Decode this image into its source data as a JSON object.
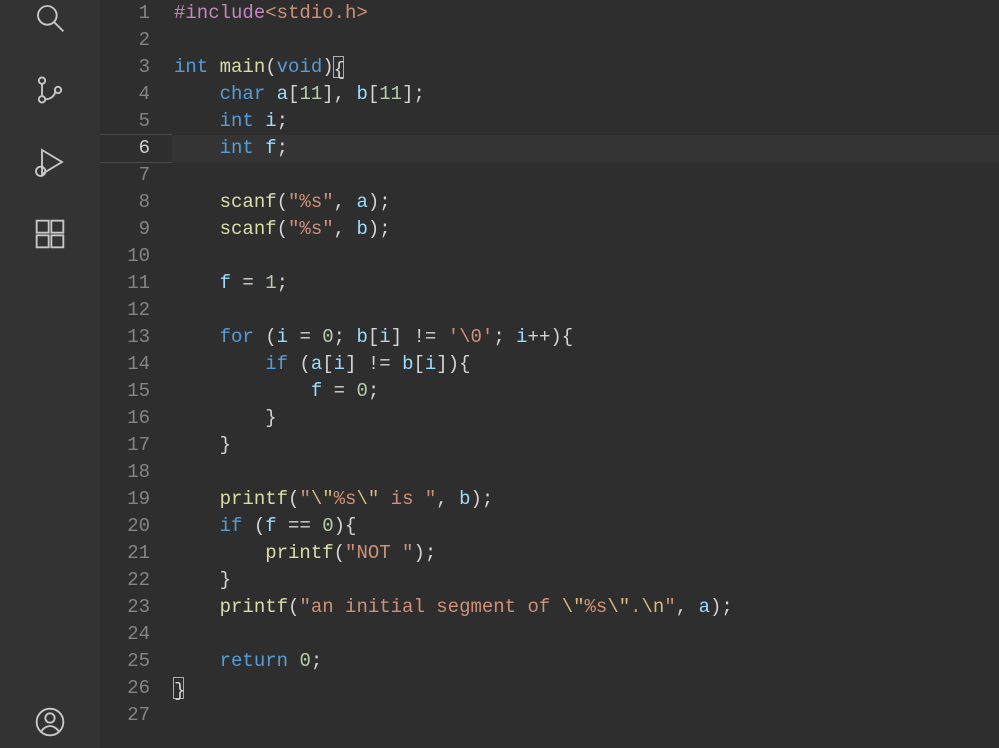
{
  "editor": {
    "active_line": 6,
    "total_lines": 27,
    "lines": [
      [
        {
          "t": "#include",
          "c": "pp"
        },
        {
          "t": "<stdio.h>",
          "c": "str"
        }
      ],
      [],
      [
        {
          "t": "int",
          "c": "type"
        },
        {
          "t": " ",
          "c": "pun"
        },
        {
          "t": "main",
          "c": "fn"
        },
        {
          "t": "(",
          "c": "pun"
        },
        {
          "t": "void",
          "c": "type"
        },
        {
          "t": ")",
          "c": "pun"
        },
        {
          "t": "{",
          "c": "pun",
          "cursor": true
        }
      ],
      [
        {
          "t": "    ",
          "c": "pun",
          "ind": 1
        },
        {
          "t": "char",
          "c": "type"
        },
        {
          "t": " ",
          "c": "pun"
        },
        {
          "t": "a",
          "c": "var"
        },
        {
          "t": "[",
          "c": "pun"
        },
        {
          "t": "11",
          "c": "num"
        },
        {
          "t": "], ",
          "c": "pun"
        },
        {
          "t": "b",
          "c": "var"
        },
        {
          "t": "[",
          "c": "pun"
        },
        {
          "t": "11",
          "c": "num"
        },
        {
          "t": "];",
          "c": "pun"
        }
      ],
      [
        {
          "t": "    ",
          "c": "pun",
          "ind": 1
        },
        {
          "t": "int",
          "c": "type"
        },
        {
          "t": " ",
          "c": "pun"
        },
        {
          "t": "i",
          "c": "var"
        },
        {
          "t": ";",
          "c": "pun"
        }
      ],
      [
        {
          "t": "    ",
          "c": "pun",
          "ind": 1
        },
        {
          "t": "int",
          "c": "type"
        },
        {
          "t": " ",
          "c": "pun"
        },
        {
          "t": "f",
          "c": "var"
        },
        {
          "t": ";",
          "c": "pun"
        }
      ],
      [
        {
          "t": "",
          "c": "pun"
        }
      ],
      [
        {
          "t": "    ",
          "c": "pun",
          "ind": 1
        },
        {
          "t": "scanf",
          "c": "fn"
        },
        {
          "t": "(",
          "c": "pun"
        },
        {
          "t": "\"%s\"",
          "c": "str"
        },
        {
          "t": ", ",
          "c": "pun"
        },
        {
          "t": "a",
          "c": "var"
        },
        {
          "t": ");",
          "c": "pun"
        }
      ],
      [
        {
          "t": "    ",
          "c": "pun",
          "ind": 1
        },
        {
          "t": "scanf",
          "c": "fn"
        },
        {
          "t": "(",
          "c": "pun"
        },
        {
          "t": "\"%s\"",
          "c": "str"
        },
        {
          "t": ", ",
          "c": "pun"
        },
        {
          "t": "b",
          "c": "var"
        },
        {
          "t": ");",
          "c": "pun"
        }
      ],
      [
        {
          "t": "",
          "c": "pun"
        }
      ],
      [
        {
          "t": "    ",
          "c": "pun",
          "ind": 1
        },
        {
          "t": "f",
          "c": "var"
        },
        {
          "t": " = ",
          "c": "op"
        },
        {
          "t": "1",
          "c": "num"
        },
        {
          "t": ";",
          "c": "pun"
        }
      ],
      [
        {
          "t": "",
          "c": "pun"
        }
      ],
      [
        {
          "t": "    ",
          "c": "pun",
          "ind": 1
        },
        {
          "t": "for",
          "c": "kw"
        },
        {
          "t": " (",
          "c": "pun"
        },
        {
          "t": "i",
          "c": "var"
        },
        {
          "t": " = ",
          "c": "op"
        },
        {
          "t": "0",
          "c": "num"
        },
        {
          "t": "; ",
          "c": "pun"
        },
        {
          "t": "b",
          "c": "var"
        },
        {
          "t": "[",
          "c": "pun"
        },
        {
          "t": "i",
          "c": "var"
        },
        {
          "t": "] != ",
          "c": "op"
        },
        {
          "t": "'\\0'",
          "c": "str"
        },
        {
          "t": "; ",
          "c": "pun"
        },
        {
          "t": "i",
          "c": "var"
        },
        {
          "t": "++){",
          "c": "pun"
        }
      ],
      [
        {
          "t": "        ",
          "c": "pun",
          "ind": 2
        },
        {
          "t": "if",
          "c": "kw"
        },
        {
          "t": " (",
          "c": "pun"
        },
        {
          "t": "a",
          "c": "var"
        },
        {
          "t": "[",
          "c": "pun"
        },
        {
          "t": "i",
          "c": "var"
        },
        {
          "t": "] != ",
          "c": "op"
        },
        {
          "t": "b",
          "c": "var"
        },
        {
          "t": "[",
          "c": "pun"
        },
        {
          "t": "i",
          "c": "var"
        },
        {
          "t": "]){",
          "c": "pun"
        }
      ],
      [
        {
          "t": "            ",
          "c": "pun",
          "ind": 3
        },
        {
          "t": "f",
          "c": "var"
        },
        {
          "t": " = ",
          "c": "op"
        },
        {
          "t": "0",
          "c": "num"
        },
        {
          "t": ";",
          "c": "pun"
        }
      ],
      [
        {
          "t": "        ",
          "c": "pun",
          "ind": 2
        },
        {
          "t": "}",
          "c": "pun"
        }
      ],
      [
        {
          "t": "    ",
          "c": "pun",
          "ind": 1
        },
        {
          "t": "}",
          "c": "pun"
        }
      ],
      [
        {
          "t": "",
          "c": "pun"
        }
      ],
      [
        {
          "t": "    ",
          "c": "pun",
          "ind": 1
        },
        {
          "t": "printf",
          "c": "fn"
        },
        {
          "t": "(",
          "c": "pun"
        },
        {
          "t": "\"",
          "c": "str"
        },
        {
          "t": "\\\"",
          "c": "esc"
        },
        {
          "t": "%s",
          "c": "str"
        },
        {
          "t": "\\\"",
          "c": "esc"
        },
        {
          "t": " is \"",
          "c": "str"
        },
        {
          "t": ", ",
          "c": "pun"
        },
        {
          "t": "b",
          "c": "var"
        },
        {
          "t": ");",
          "c": "pun"
        }
      ],
      [
        {
          "t": "    ",
          "c": "pun",
          "ind": 1
        },
        {
          "t": "if",
          "c": "kw"
        },
        {
          "t": " (",
          "c": "pun"
        },
        {
          "t": "f",
          "c": "var"
        },
        {
          "t": " == ",
          "c": "op"
        },
        {
          "t": "0",
          "c": "num"
        },
        {
          "t": "){",
          "c": "pun"
        }
      ],
      [
        {
          "t": "        ",
          "c": "pun",
          "ind": 2
        },
        {
          "t": "printf",
          "c": "fn"
        },
        {
          "t": "(",
          "c": "pun"
        },
        {
          "t": "\"NOT \"",
          "c": "str"
        },
        {
          "t": ");",
          "c": "pun"
        }
      ],
      [
        {
          "t": "    ",
          "c": "pun",
          "ind": 1
        },
        {
          "t": "}",
          "c": "pun"
        }
      ],
      [
        {
          "t": "    ",
          "c": "pun",
          "ind": 1
        },
        {
          "t": "printf",
          "c": "fn"
        },
        {
          "t": "(",
          "c": "pun"
        },
        {
          "t": "\"an initial segment of ",
          "c": "str"
        },
        {
          "t": "\\\"",
          "c": "esc"
        },
        {
          "t": "%s",
          "c": "str"
        },
        {
          "t": "\\\"",
          "c": "esc"
        },
        {
          "t": ".",
          "c": "str"
        },
        {
          "t": "\\n",
          "c": "esc"
        },
        {
          "t": "\"",
          "c": "str"
        },
        {
          "t": ", ",
          "c": "pun"
        },
        {
          "t": "a",
          "c": "var"
        },
        {
          "t": ");",
          "c": "pun"
        }
      ],
      [
        {
          "t": "",
          "c": "pun"
        }
      ],
      [
        {
          "t": "    ",
          "c": "pun",
          "ind": 1
        },
        {
          "t": "return",
          "c": "kw"
        },
        {
          "t": " ",
          "c": "pun"
        },
        {
          "t": "0",
          "c": "num"
        },
        {
          "t": ";",
          "c": "pun"
        }
      ],
      [
        {
          "t": "}",
          "c": "pun",
          "cursor_end": true
        }
      ],
      [
        {
          "t": "",
          "c": "pun"
        }
      ]
    ]
  },
  "activity_bar": {
    "items": [
      "search",
      "source-control",
      "run-debug",
      "extensions"
    ],
    "bottom": [
      "account"
    ]
  }
}
